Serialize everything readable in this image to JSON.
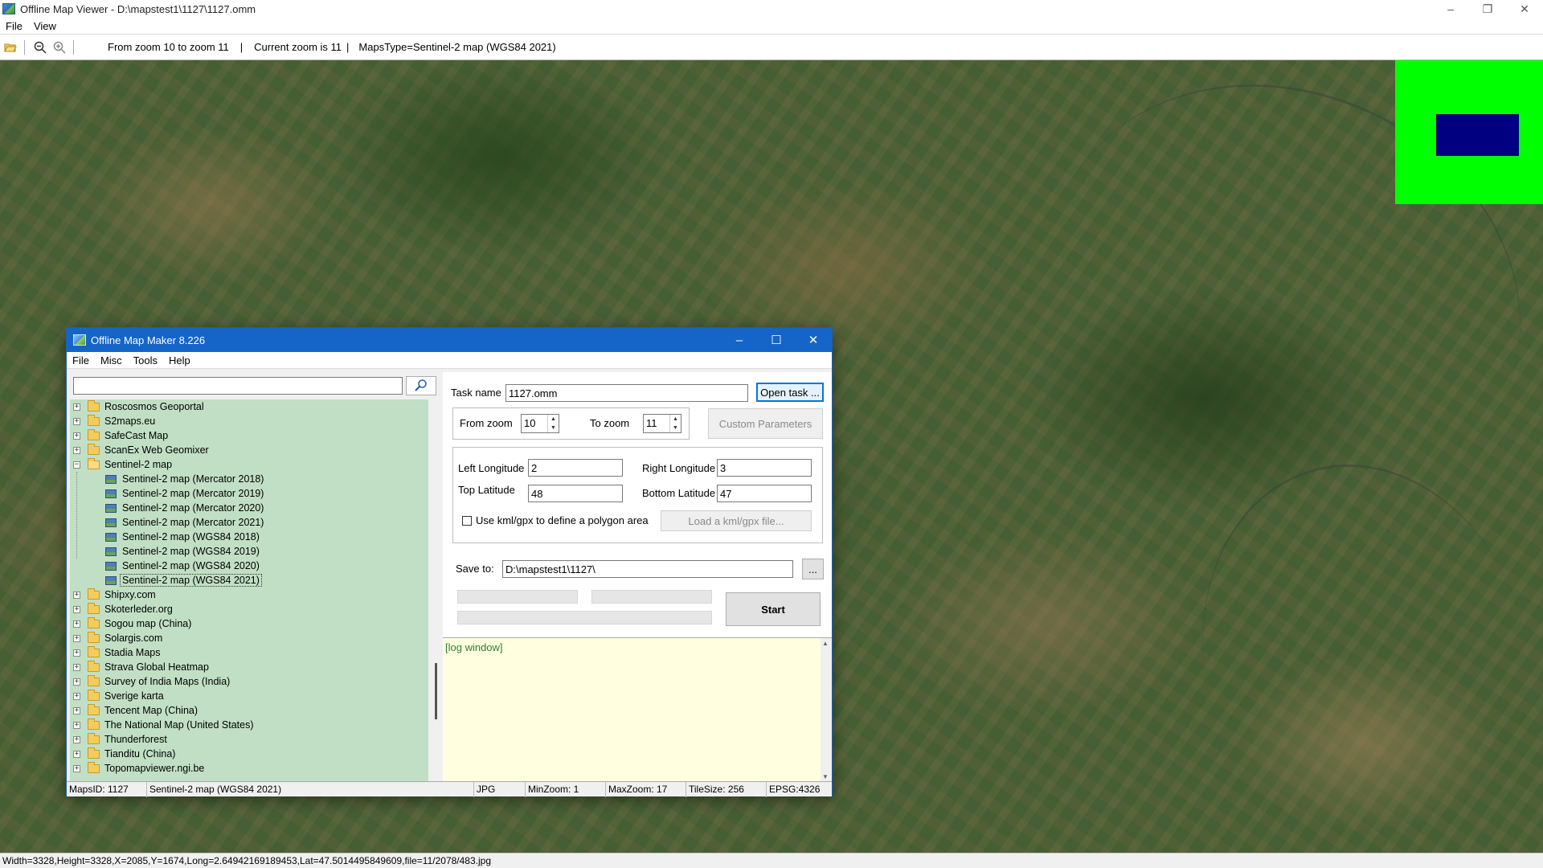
{
  "app": {
    "title": "Offline Map Viewer - D:\\mapstest1\\1127\\1127.omm",
    "menu": [
      "File",
      "View"
    ],
    "window_controls": {
      "minimize": "–",
      "restore": "❐",
      "close": "✕"
    }
  },
  "toolbar": {
    "icons": [
      "folder-open-icon",
      "zoom-out-icon",
      "zoom-in-icon"
    ],
    "zoom_range": "From zoom 10 to zoom 11",
    "current_zoom": "Current zoom is 11",
    "maps_type": "MapsType=Sentinel-2 map (WGS84 2021)",
    "separator": "|"
  },
  "overview": {
    "background": "#00ff00",
    "viewport_color": "#000080"
  },
  "statusbar": {
    "text": "Width=3328,Height=3328,X=2085,Y=1674,Long=2.64942169189453,Lat=47.5014495849609,file=11/2078/483.jpg"
  },
  "dialog": {
    "title": "Offline Map Maker 8.226",
    "menu": [
      "File",
      "Misc",
      "Tools",
      "Help"
    ],
    "search": {
      "value": "",
      "icon": "search-icon"
    },
    "tree": {
      "before": [
        "Roscosmos Geoportal",
        "S2maps.eu",
        "SafeCast Map",
        "ScanEx Web Geomixer"
      ],
      "expanded": {
        "label": "Sentinel-2 map",
        "children": [
          "Sentinel-2 map (Mercator 2018)",
          "Sentinel-2 map (Mercator 2019)",
          "Sentinel-2 map (Mercator 2020)",
          "Sentinel-2 map (Mercator 2021)",
          "Sentinel-2 map (WGS84 2018)",
          "Sentinel-2 map (WGS84 2019)",
          "Sentinel-2 map (WGS84 2020)",
          "Sentinel-2 map (WGS84 2021)"
        ],
        "selected": "Sentinel-2 map (WGS84 2021)"
      },
      "after": [
        "Shipxy.com",
        "Skoterleder.org",
        "Sogou map (China)",
        "Solargis.com",
        "Stadia Maps",
        "Strava Global Heatmap",
        "Survey of India Maps (India)",
        "Sverige karta",
        "Tencent Map (China)",
        "The National Map (United States)",
        "Thunderforest",
        "Tianditu (China)",
        "Topomapviewer.ngi.be"
      ]
    },
    "form": {
      "task_name_label": "Task name",
      "task_name_value": "1127.omm",
      "open_task_label": "Open task ...",
      "from_zoom_label": "From zoom",
      "from_zoom_value": "10",
      "to_zoom_label": "To zoom",
      "to_zoom_value": "11",
      "custom_params_label": "Custom Parameters",
      "left_lon_label": "Left Longitude",
      "left_lon_value": "2",
      "right_lon_label": "Right Longitude",
      "right_lon_value": "3",
      "top_lat_label": "Top Latitude",
      "top_lat_value": "48",
      "bottom_lat_label": "Bottom Latitude",
      "bottom_lat_value": "47",
      "kml_check_label": "Use kml/gpx to define a polygon area",
      "kml_checked": false,
      "load_kml_label": "Load a kml/gpx file...",
      "save_to_label": "Save to:",
      "save_to_value": "D:\\mapstest1\\1127\\",
      "browse_label": "...",
      "start_label": "Start",
      "progress": [
        0,
        0,
        0
      ]
    },
    "log": {
      "text": "[log window]"
    },
    "status": {
      "maps_id": "MapsID: 1127",
      "map_name": "Sentinel-2 map (WGS84 2021)",
      "format": "JPG",
      "min_zoom": "MinZoom: 1",
      "max_zoom": "MaxZoom: 17",
      "tile_size": "TileSize: 256",
      "epsg": "EPSG:4326"
    }
  }
}
